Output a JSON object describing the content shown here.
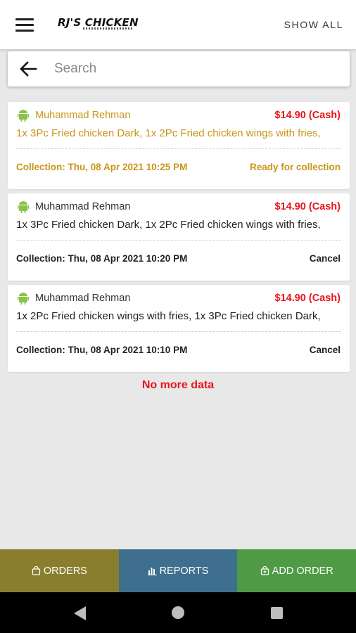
{
  "header": {
    "logo_text": "RJ'S CHICKEN",
    "show_all_label": "SHOW ALL"
  },
  "search": {
    "placeholder": "Search",
    "value": ""
  },
  "orders": [
    {
      "customer": "Muhammad Rehman",
      "price": "$14.90 (Cash)",
      "items": "1x 3Pc Fried chicken Dark, 1x 2Pc Fried chicken wings with fries,",
      "collection": "Collection: Thu, 08 Apr 2021 10:25 PM",
      "action": "Ready for collection",
      "status": "ready"
    },
    {
      "customer": "Muhammad Rehman",
      "price": "$14.90 (Cash)",
      "items": "1x 3Pc Fried chicken Dark, 1x 2Pc Fried chicken wings with fries,",
      "collection": "Collection: Thu, 08 Apr 2021 10:20 PM",
      "action": "Cancel",
      "status": "pending"
    },
    {
      "customer": "Muhammad Rehman",
      "price": "$14.90 (Cash)",
      "items": "1x 2Pc Fried chicken wings with fries, 1x 3Pc Fried chicken Dark,",
      "collection": "Collection: Thu, 08 Apr 2021 10:10 PM",
      "action": "Cancel",
      "status": "pending"
    }
  ],
  "no_more_data": "No more data",
  "tabs": [
    {
      "label": "ORDERS",
      "icon": "bag-icon",
      "color": "#8a7e2e"
    },
    {
      "label": "REPORTS",
      "icon": "bar-chart-icon",
      "color": "#3e6f8e"
    },
    {
      "label": "ADD ORDER",
      "icon": "bag-plus-icon",
      "color": "#4f9a45"
    }
  ],
  "colors": {
    "price_red": "#e8151b",
    "ready_gold": "#c89618",
    "android_green": "#8bc34a"
  }
}
